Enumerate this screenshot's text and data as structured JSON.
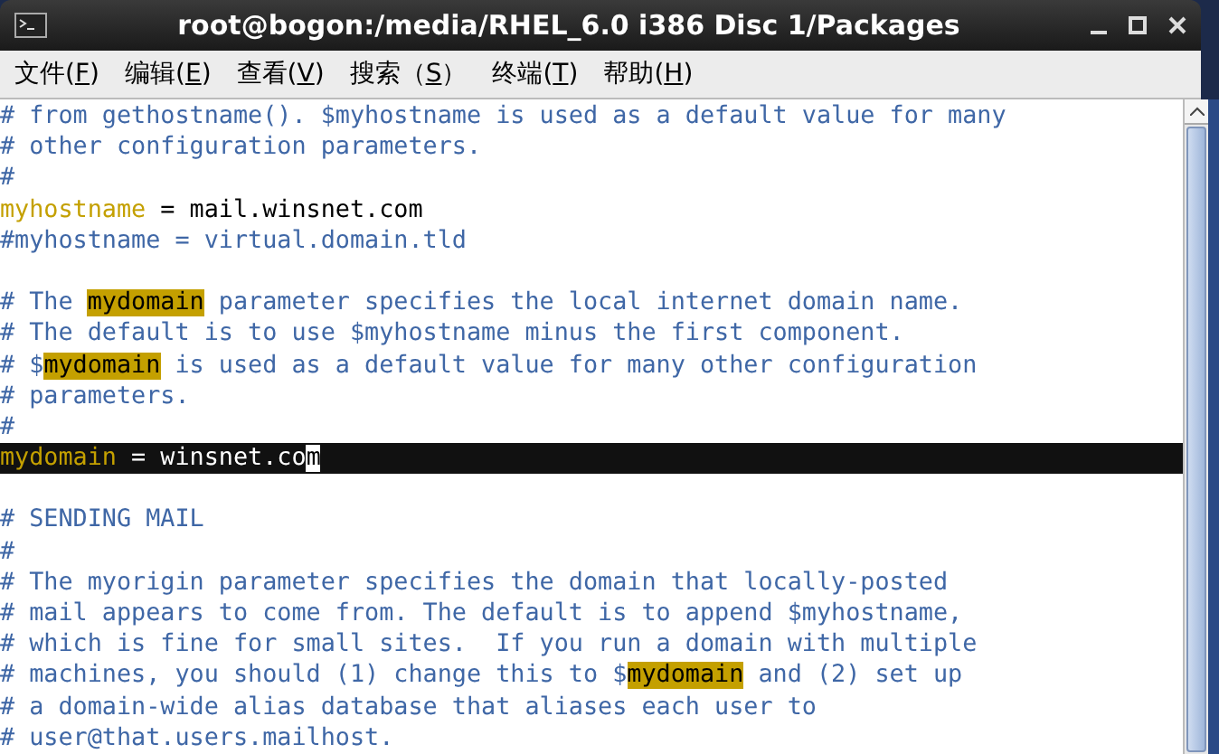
{
  "window": {
    "title": "root@bogon:/media/RHEL_6.0 i386 Disc 1/Packages"
  },
  "menu": [
    {
      "label": "文件(",
      "key": "F",
      "end": ")"
    },
    {
      "label": "编辑(",
      "key": "E",
      "end": ")"
    },
    {
      "label": "查看(",
      "key": "V",
      "end": ")"
    },
    {
      "label": "搜索（",
      "key": "S",
      "end": "）"
    },
    {
      "label": "终端(",
      "key": "T",
      "end": ")"
    },
    {
      "label": "帮助(",
      "key": "H",
      "end": ")"
    }
  ],
  "paragraphs": [
    {
      "lines": [
        {
          "segments": [
            {
              "kind": "comment",
              "text": "# from gethostname(). $myhostname is used as a default value for many"
            }
          ]
        },
        {
          "segments": [
            {
              "kind": "comment",
              "text": "# other configuration parameters."
            }
          ]
        },
        {
          "segments": [
            {
              "kind": "comment",
              "text": "#"
            }
          ]
        },
        {
          "segments": [
            {
              "kind": "identifier",
              "text": "myhostname"
            },
            {
              "kind": "plain",
              "text": " = mail.winsnet.com"
            }
          ]
        },
        {
          "segments": [
            {
              "kind": "comment",
              "text": "#myhostname = virtual.domain.tld"
            }
          ]
        }
      ]
    },
    {
      "lines": [
        {
          "segments": [
            {
              "kind": "comment",
              "text": "# The "
            },
            {
              "kind": "match",
              "text": "mydomain"
            },
            {
              "kind": "comment",
              "text": " parameter specifies the local internet domain name."
            }
          ]
        },
        {
          "segments": [
            {
              "kind": "comment",
              "text": "# The default is to use $myhostname minus the first component."
            }
          ]
        },
        {
          "segments": [
            {
              "kind": "comment",
              "text": "# $"
            },
            {
              "kind": "match",
              "text": "mydomain"
            },
            {
              "kind": "comment",
              "text": " is used as a default value for many other configuration"
            }
          ]
        },
        {
          "segments": [
            {
              "kind": "comment",
              "text": "# parameters."
            }
          ]
        },
        {
          "segments": [
            {
              "kind": "comment",
              "text": "#"
            }
          ]
        },
        {
          "current": true,
          "segments": [
            {
              "kind": "identifier",
              "text": "mydomain"
            },
            {
              "kind": "plain",
              "text": " = winsnet.co"
            },
            {
              "kind": "cursor",
              "text": "m"
            }
          ]
        }
      ]
    },
    {
      "lines": [
        {
          "segments": [
            {
              "kind": "comment",
              "text": "# SENDING MAIL"
            }
          ]
        },
        {
          "segments": [
            {
              "kind": "comment",
              "text": "#"
            }
          ]
        },
        {
          "segments": [
            {
              "kind": "comment",
              "text": "# The myorigin parameter specifies the domain that locally-posted"
            }
          ]
        },
        {
          "segments": [
            {
              "kind": "comment",
              "text": "# mail appears to come from. The default is to append $myhostname,"
            }
          ]
        },
        {
          "segments": [
            {
              "kind": "comment",
              "text": "# which is fine for small sites.  If you run a domain with multiple"
            }
          ]
        },
        {
          "segments": [
            {
              "kind": "comment",
              "text": "# machines, you should (1) change this to $"
            },
            {
              "kind": "match",
              "text": "mydomain"
            },
            {
              "kind": "comment",
              "text": " and (2) set up"
            }
          ]
        },
        {
          "segments": [
            {
              "kind": "comment",
              "text": "# a domain-wide alias database that aliases each user to"
            }
          ]
        },
        {
          "segments": [
            {
              "kind": "comment",
              "text": "# user@that.users.mailhost."
            }
          ]
        }
      ]
    }
  ]
}
